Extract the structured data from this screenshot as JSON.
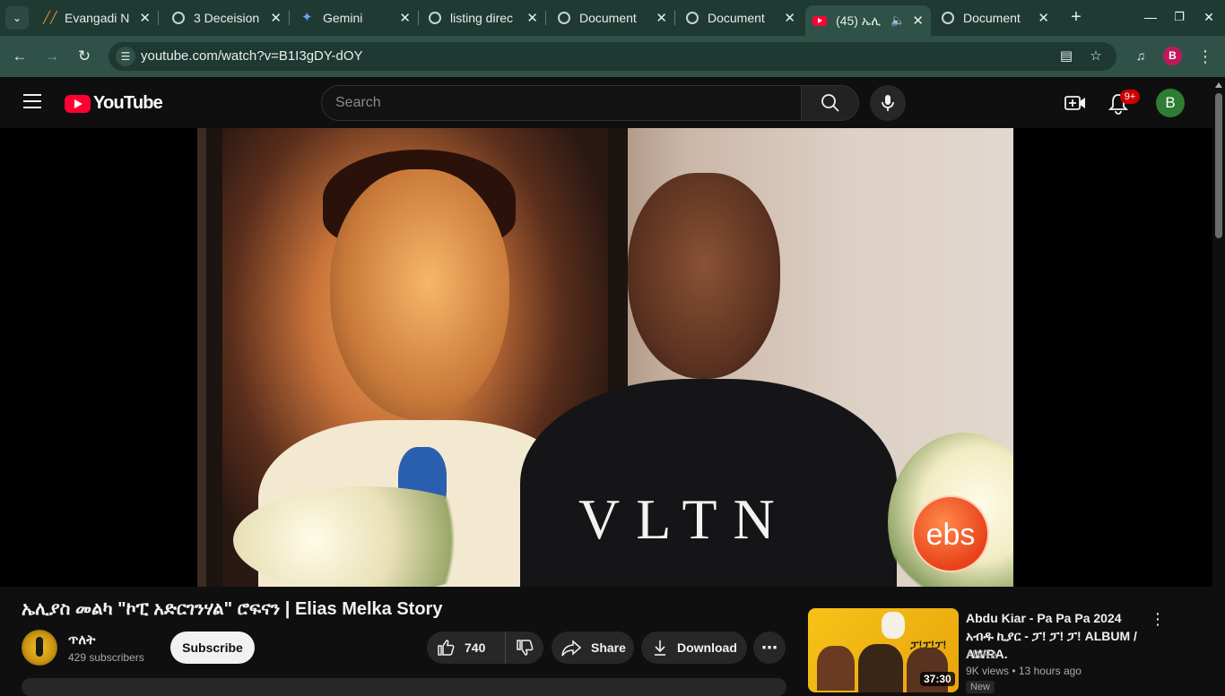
{
  "browser": {
    "tabs": [
      {
        "title": "Evangadi N",
        "icon": "evangadi-icon"
      },
      {
        "title": "3 Deceision",
        "icon": "globe-icon"
      },
      {
        "title": "Gemini",
        "icon": "gemini-icon"
      },
      {
        "title": "listing direc",
        "icon": "globe-icon"
      },
      {
        "title": "Document",
        "icon": "globe-icon"
      },
      {
        "title": "Document",
        "icon": "globe-icon"
      },
      {
        "title": "(45) ኤሊ",
        "icon": "youtube-icon",
        "active": true,
        "audio": true
      },
      {
        "title": "Document",
        "icon": "globe-icon"
      }
    ],
    "url": "youtube.com/watch?v=B1I3gDY-dOY",
    "profile_initial": "B",
    "colors": {
      "frame": "#1f3a33",
      "toolbar": "#2f5147",
      "profile": "#c2185b"
    }
  },
  "youtube": {
    "logo_text": "YouTube",
    "search_placeholder": "Search",
    "notification_badge": "9+",
    "avatar_initial": "B",
    "colors": {
      "brand_red": "#ff0033",
      "avatar": "#2e7d32",
      "badge": "#cc0000"
    }
  },
  "video": {
    "title": "ኤሊያስ መልካ \"ኮፒ አድርገንሃል\" ሮፍናን | Elias Melka Story",
    "channel_name": "ጥለት",
    "subscribers": "429 subscribers",
    "subscribe_label": "Subscribe",
    "likes": "740",
    "share_label": "Share",
    "download_label": "Download",
    "watermark": "ebs",
    "shirt_text": "VLTN"
  },
  "recommendation": {
    "title": "Abdu Kiar - Pa Pa Pa 2024 አብዱ ኪያር - ፓ! ፓ! ፓ! ALBUM / AWRA.",
    "channel": "AWRA",
    "views": "9K views",
    "age": "13 hours ago",
    "badge": "New",
    "duration": "37:30",
    "thumb_text": "ፓ!ፓ!ፓ!"
  }
}
